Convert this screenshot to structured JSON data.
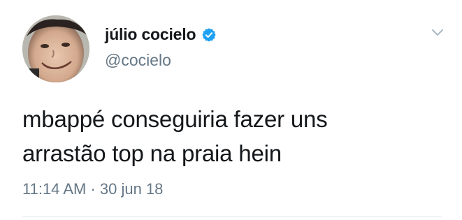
{
  "tweet": {
    "author": {
      "display_name": "júlio cocielo",
      "handle": "@cocielo",
      "verified": true,
      "avatar_icon": "user-avatar"
    },
    "text": "mbappé conseguiria fazer uns\narrastão top na praia hein",
    "timestamp": "11:14 AM · 30 jun 18",
    "menu_icon": "chevron-down-icon"
  },
  "colors": {
    "text_primary": "#14171a",
    "text_secondary": "#657786",
    "verified_blue": "#1da1f2",
    "divider": "#e1e8ed"
  }
}
